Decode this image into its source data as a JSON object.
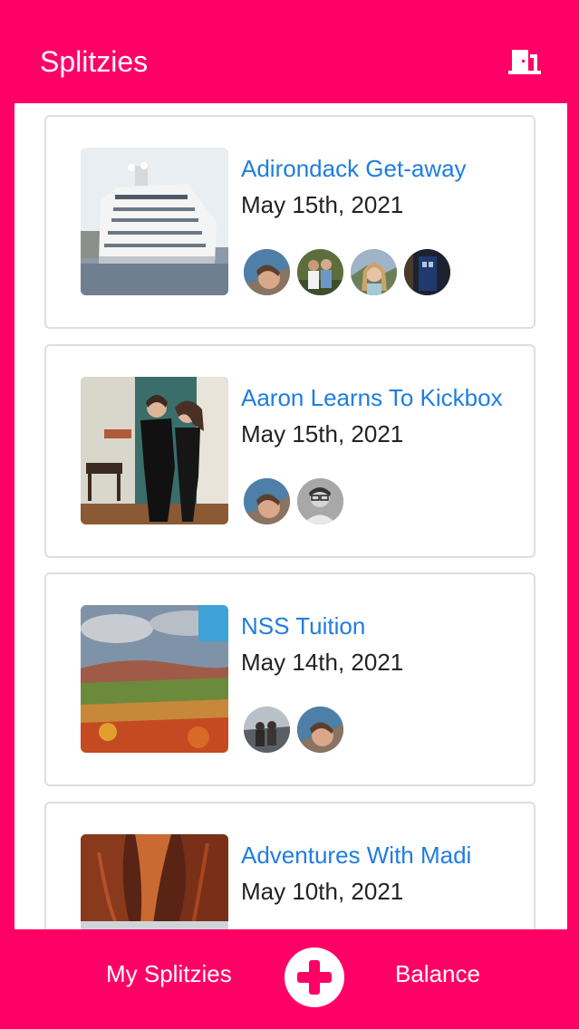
{
  "app": {
    "title": "Splitzies"
  },
  "header": {
    "logout_icon": "door-exit-icon"
  },
  "splitzies": [
    {
      "title": "Adirondack Get-away",
      "date": "May 15th, 2021",
      "image": "cruise-ship",
      "member_count": 4
    },
    {
      "title": "Aaron Learns To Kickbox",
      "date": "May 15th, 2021",
      "image": "two-people-indoors",
      "member_count": 2
    },
    {
      "title": "NSS Tuition",
      "date": "May 14th, 2021",
      "image": "autumn-valley",
      "member_count": 2
    },
    {
      "title": "Adventures With Madi",
      "date": "May 10th, 2021",
      "image": "red-canyon",
      "member_count": 0
    }
  ],
  "footer": {
    "my_splitzies_label": "My Splitzies",
    "add_icon": "plus-icon",
    "balance_label": "Balance"
  },
  "colors": {
    "brand": "#ff0066",
    "link": "#1f7de0",
    "text": "#222222",
    "border": "#dedede"
  }
}
